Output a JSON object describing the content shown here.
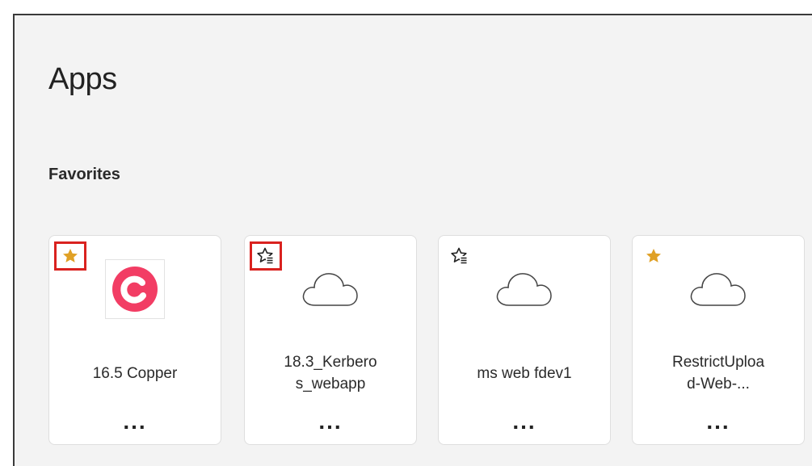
{
  "page": {
    "title": "Apps"
  },
  "favorites": {
    "title": "Favorites",
    "apps": [
      {
        "name": "16.5 Copper",
        "favorited": true,
        "icon": "copper-logo",
        "more": "..."
      },
      {
        "name": "18.3_Kerbero\ns_webapp",
        "favorited": false,
        "icon": "cloud-icon",
        "more": "..."
      },
      {
        "name": "ms web fdev1",
        "favorited": false,
        "icon": "cloud-icon",
        "more": "..."
      },
      {
        "name": "RestrictUploa\nd-Web-...",
        "favorited": true,
        "icon": "cloud-icon",
        "more": "..."
      }
    ]
  },
  "colors": {
    "star_filled": "#e0a126",
    "highlight_border": "#d9221f",
    "copper_brand": "#f23d64",
    "panel_bg": "#f3f3f3",
    "tile_bg": "#ffffff"
  }
}
